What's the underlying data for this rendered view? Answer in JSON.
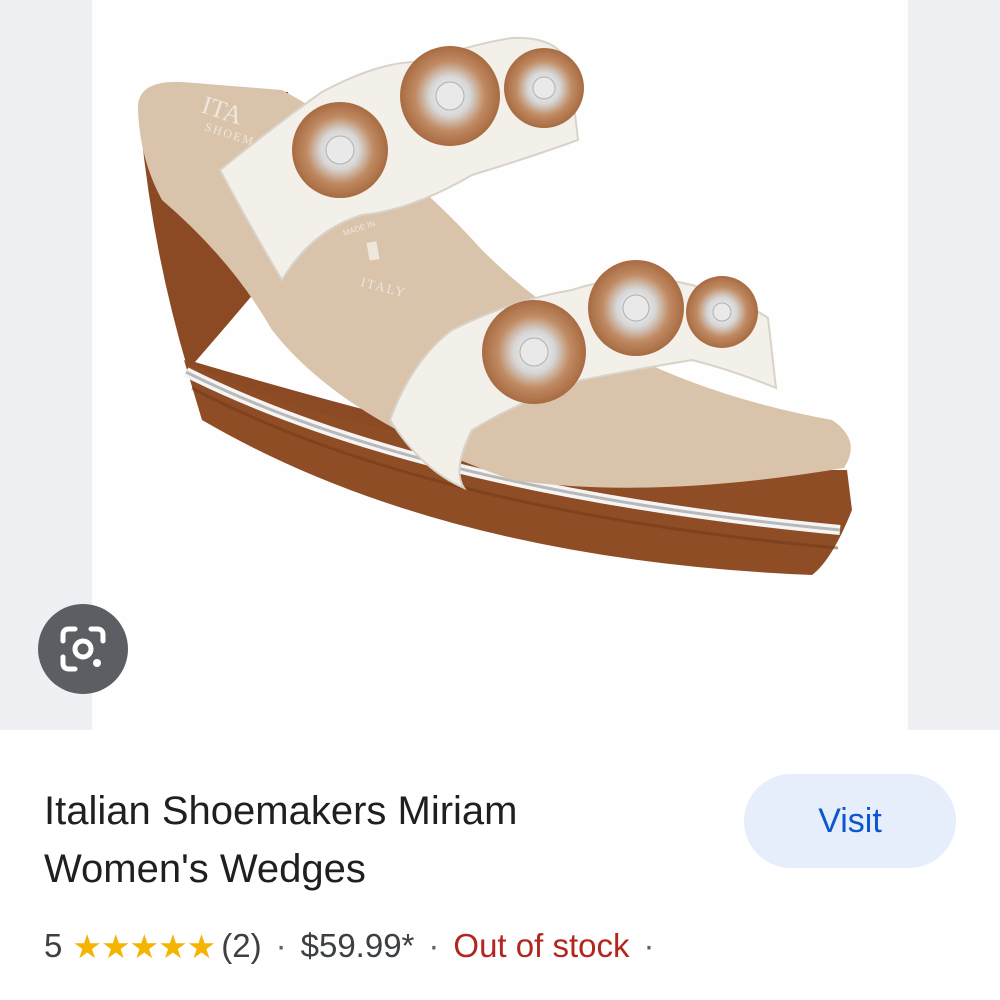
{
  "product": {
    "title_line1": "Italian Shoemakers Miriam",
    "title_line2": "Women's Wedges",
    "rating": 5,
    "stars": "★★★★★",
    "review_count": "(2)",
    "separator": "·",
    "price": "$59.99*",
    "stock_status": "Out of stock",
    "insole_print": {
      "brand_line1": "ITA",
      "brand_line2": "SHOEM",
      "made_in": "MADE IN",
      "country": "ITALY"
    }
  },
  "actions": {
    "visit_label": "Visit"
  },
  "icons": {
    "lens": "google-lens-icon"
  },
  "colors": {
    "visit_bg": "#e6edfb",
    "visit_text": "#0b57d0",
    "stars": "#f4b400",
    "out_of_stock": "#b3261e",
    "wedge": "#8b4a24",
    "strap": "#f3f0ea",
    "insole": "#d9c3ab"
  }
}
